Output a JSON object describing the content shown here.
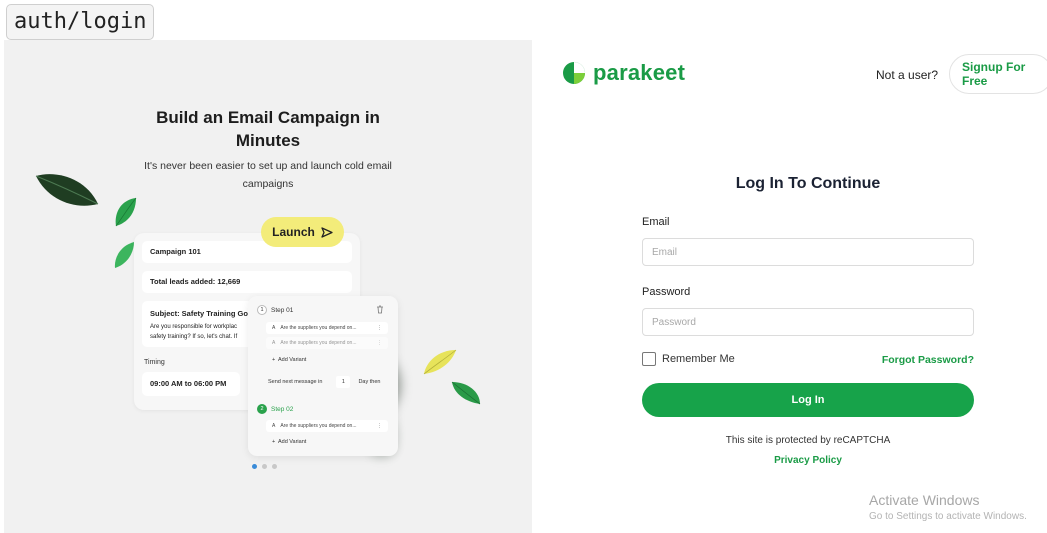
{
  "route": "auth/login",
  "promo": {
    "title_line1": "Build an Email Campaign in",
    "title_line2": "Minutes",
    "subtitle_line1": "It's never been easier to set up and launch cold email",
    "subtitle_line2": "campaigns",
    "launch_label": "Launch",
    "campaign": {
      "name": "Campaign 101",
      "leads": "Total leads added: 12,669",
      "subject": "Subject: Safety Training Go",
      "body_line1": "Are you responsible for workplac",
      "body_line2": "safety training? If so, let's chat. If",
      "timing_label": "Timing",
      "timing_value": "09:00 AM to 06:00 PM"
    },
    "steps": {
      "step1_num": "1",
      "step1_label": "Step 01",
      "variant_a_letter": "A",
      "variant_a_text": "Are the suppliers you depend on...",
      "variant_b_letter": "A",
      "variant_b_text": "Are the suppliers you depend on...",
      "add_variant": "Add Variant",
      "send_next": "Send next message in",
      "days_value": "1",
      "days_after": "Day then",
      "step2_num": "2",
      "step2_label": "Step 02",
      "variant_c_letter": "A",
      "variant_c_text": "Are the suppliers you depend on...",
      "add_variant2": "Add Variant"
    },
    "leaf_color": "#2aa24c"
  },
  "header": {
    "brand": "parakeet",
    "not_user": "Not a user?",
    "signup": "Signup For Free",
    "brand_color": "#1a9b46"
  },
  "login": {
    "title": "Log In To Continue",
    "email_label": "Email",
    "email_placeholder": "Email",
    "email_value": "",
    "password_label": "Password",
    "password_placeholder": "Password",
    "password_value": "",
    "remember": "Remember Me",
    "forgot": "Forgot Password?",
    "submit": "Log In",
    "recaptcha": "This site is protected by reCAPTCHA",
    "privacy": "Privacy Policy",
    "button_color": "#17a34a"
  },
  "watermark": {
    "title": "Activate Windows",
    "subtitle": "Go to Settings to activate Windows."
  }
}
